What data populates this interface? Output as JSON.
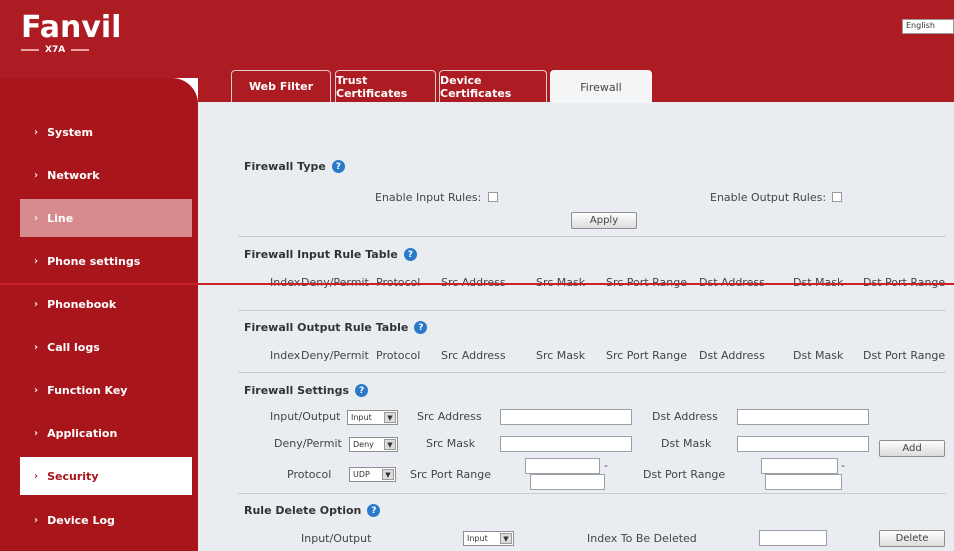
{
  "header": {
    "logo": "Fanvil",
    "model": "X7A",
    "language": "English"
  },
  "sidebar": {
    "items": [
      {
        "label": "System",
        "state": "normal"
      },
      {
        "label": "Network",
        "state": "normal"
      },
      {
        "label": "Line",
        "state": "hover"
      },
      {
        "label": "Phone settings",
        "state": "normal"
      },
      {
        "label": "Phonebook",
        "state": "normal"
      },
      {
        "label": "Call logs",
        "state": "normal"
      },
      {
        "label": "Function Key",
        "state": "normal"
      },
      {
        "label": "Application",
        "state": "normal"
      },
      {
        "label": "Security",
        "state": "active"
      },
      {
        "label": "Device Log",
        "state": "normal"
      }
    ]
  },
  "tabs": [
    {
      "label": "Web Filter"
    },
    {
      "label": "Trust Certificates"
    },
    {
      "label": "Device Certificates"
    },
    {
      "label": "Firewall",
      "active": true
    }
  ],
  "firewall_type": {
    "title": "Firewall Type",
    "enable_input_label": "Enable Input Rules:",
    "enable_output_label": "Enable Output Rules:",
    "apply_label": "Apply"
  },
  "input_table": {
    "title": "Firewall Input Rule Table",
    "columns": [
      "Index",
      "Deny/Permit",
      "Protocol",
      "Src Address",
      "Src Mask",
      "Src Port Range",
      "Dst Address",
      "Dst Mask",
      "Dst Port Range"
    ]
  },
  "output_table": {
    "title": "Firewall Output Rule Table",
    "columns": [
      "Index",
      "Deny/Permit",
      "Protocol",
      "Src Address",
      "Src Mask",
      "Src Port Range",
      "Dst Address",
      "Dst Mask",
      "Dst Port Range"
    ]
  },
  "settings": {
    "title": "Firewall Settings",
    "io_label": "Input/Output",
    "io_value": "Input",
    "dp_label": "Deny/Permit",
    "dp_value": "Deny",
    "protocol_label": "Protocol",
    "protocol_value": "UDP",
    "src_address_label": "Src Address",
    "src_mask_label": "Src Mask",
    "src_port_label": "Src Port Range",
    "dst_address_label": "Dst Address",
    "dst_mask_label": "Dst Mask",
    "dst_port_label": "Dst Port Range",
    "range_sep": "-",
    "add_label": "Add"
  },
  "delete": {
    "title": "Rule Delete Option",
    "io_label": "Input/Output",
    "io_value": "Input",
    "index_label": "Index To Be Deleted",
    "delete_label": "Delete"
  }
}
